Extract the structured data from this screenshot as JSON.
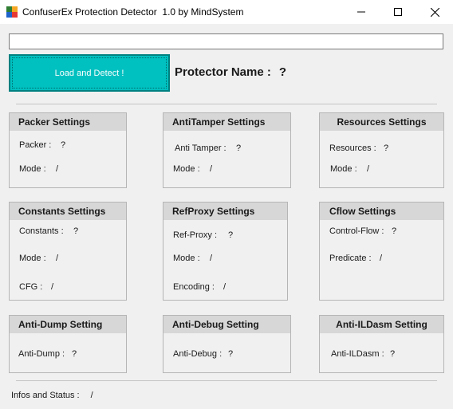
{
  "window": {
    "title": "ConfuserEx Protection Detector  1.0 by MindSystem"
  },
  "path_input": {
    "value": ""
  },
  "load_button": {
    "label": "Load and Detect !"
  },
  "protector": {
    "label": "Protector Name :",
    "value": "?"
  },
  "groups": {
    "packer": {
      "title": "Packer Settings",
      "fields": [
        {
          "label": "Packer :",
          "value": "?"
        },
        {
          "label": "Mode :",
          "value": "/"
        }
      ]
    },
    "antitamper": {
      "title": "AntiTamper Settings",
      "fields": [
        {
          "label": "Anti Tamper :",
          "value": "?"
        },
        {
          "label": "Mode :",
          "value": "/"
        }
      ]
    },
    "resources": {
      "title": "Resources Settings",
      "fields": [
        {
          "label": "Resources :",
          "value": "?"
        },
        {
          "label": "Mode :",
          "value": "/"
        }
      ]
    },
    "constants": {
      "title": "Constants Settings",
      "fields": [
        {
          "label": "Constants :",
          "value": "?"
        },
        {
          "label": "Mode :",
          "value": "/"
        },
        {
          "label": "CFG :",
          "value": "/"
        }
      ]
    },
    "refproxy": {
      "title": "RefProxy Settings",
      "fields": [
        {
          "label": "Ref-Proxy :",
          "value": "?"
        },
        {
          "label": "Mode :",
          "value": "/"
        },
        {
          "label": "Encoding :",
          "value": "/"
        }
      ]
    },
    "cflow": {
      "title": "Cflow Settings",
      "fields": [
        {
          "label": "Control-Flow :",
          "value": "?"
        },
        {
          "label": "Predicate :",
          "value": "/"
        }
      ]
    },
    "antidump": {
      "title": "Anti-Dump Setting",
      "fields": [
        {
          "label": "Anti-Dump :",
          "value": "?"
        }
      ]
    },
    "antidebug": {
      "title": "Anti-Debug Setting",
      "fields": [
        {
          "label": "Anti-Debug :",
          "value": "?"
        }
      ]
    },
    "antiildasm": {
      "title": "Anti-ILDasm Setting",
      "fields": [
        {
          "label": "Anti-ILDasm :",
          "value": "?"
        }
      ]
    }
  },
  "status": {
    "label": "Infos and Status :",
    "value": "/"
  }
}
